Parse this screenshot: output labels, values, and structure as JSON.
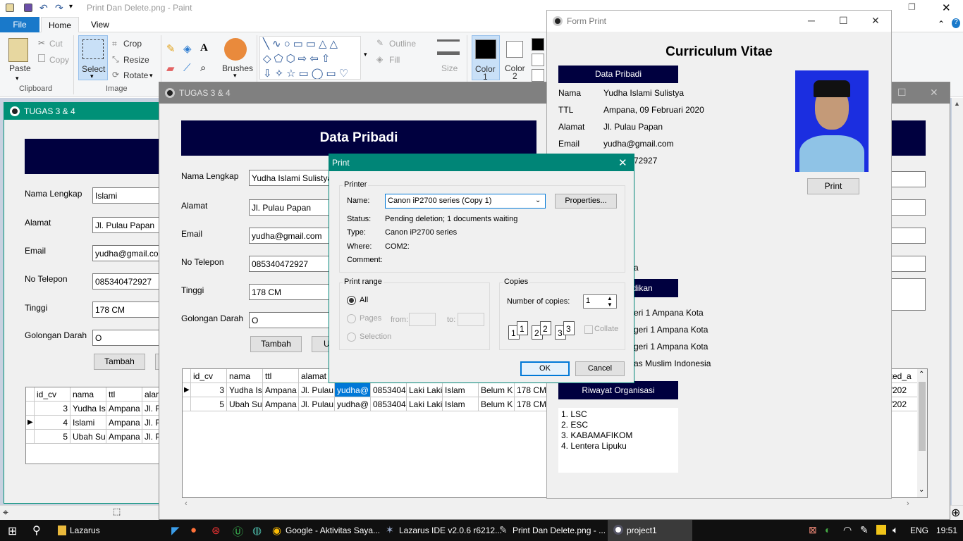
{
  "paint": {
    "title": "Print Dan Delete.png - Paint",
    "tabs": [
      "File",
      "Home",
      "View"
    ],
    "clipboard": {
      "paste": "Paste",
      "cut": "Cut",
      "copy": "Copy",
      "label": "Clipboard"
    },
    "image": {
      "select": "Select",
      "crop": "Crop",
      "resize": "Resize",
      "rotate": "Rotate",
      "label": "Image"
    },
    "tools": {
      "brushes": "Brushes",
      "outline": "Outline",
      "fill": "Fill",
      "size": "Size",
      "color1": "Color",
      "color1n": "1",
      "color2": "Color",
      "color2n": "2"
    }
  },
  "win_left": {
    "title": "TUGAS 3 & 4",
    "labels": [
      "Nama Lengkap",
      "Alamat",
      "Email",
      "No Telepon",
      "Tinggi",
      "Golongan Darah"
    ],
    "values": [
      "Islami",
      "Jl. Pulau Papan",
      "yudha@gmail.com",
      "085340472927",
      "178 CM",
      "O"
    ],
    "tambah": "Tambah",
    "grid": {
      "cols": [
        "id_cv",
        "nama",
        "ttl",
        "alamat"
      ],
      "rows": [
        [
          "3",
          "Yudha Is",
          "Ampana",
          "Jl. P"
        ],
        [
          "4",
          "Islami",
          "Ampana",
          "Jl. P"
        ],
        [
          "5",
          "Ubah Su",
          "Ampana",
          "Jl. P"
        ]
      ]
    }
  },
  "win_mid": {
    "title": "TUGAS 3 & 4",
    "header": "Data Pribadi",
    "labels": [
      "Nama Lengkap",
      "Alamat",
      "Email",
      "No Telepon",
      "Tinggi",
      "Golongan Darah"
    ],
    "values": [
      "Yudha Islami Sulistya",
      "Jl. Pulau Papan",
      "yudha@gmail.com",
      "085340472927",
      "178 CM",
      "O"
    ],
    "tambah": "Tambah",
    "ubah": "U",
    "grid": {
      "cols": [
        "id_cv",
        "nama",
        "ttl",
        "alamat",
        "",
        "",
        "",
        "",
        "",
        "",
        "",
        "ated_a"
      ],
      "rows": [
        [
          "3",
          "Yudha Is",
          "Ampana",
          "Jl. Pulau",
          "yudha@",
          "08534047",
          "Laki Laki",
          "Islam",
          "Belum K",
          "178 CM",
          "",
          "6/202"
        ],
        [
          "5",
          "Ubah Su",
          "Ampana",
          "Jl. Pulau",
          "yudha@",
          "08534047",
          "Laki Laki",
          "Islam",
          "Belum K",
          "178 CM",
          "",
          "6/202"
        ]
      ]
    }
  },
  "form_print": {
    "title": "Form Print",
    "heading": "Curriculum Vitae",
    "sec1": "Data Pribadi",
    "fields": [
      {
        "k": "Nama",
        "v": "Yudha Islami Sulistya"
      },
      {
        "k": "TTL",
        "v": "Ampana, 09 Februari 2020"
      },
      {
        "k": "Alamat",
        "v": "Jl. Pulau Papan"
      },
      {
        "k": "Email",
        "v": "yudha@gmail.com"
      }
    ],
    "phone_partial": "72927",
    "gender_partial": "a",
    "sec2_partial": "dikan",
    "edu": [
      "eri 1 Ampana Kota",
      "geri 1 Ampana Kota",
      "geri 1 Ampana Kota",
      "as Muslim Indonesia"
    ],
    "sec3": "Riwayat Organisasi",
    "orgs": [
      "1. LSC",
      "2. ESC",
      "3. KABAMAFIKOM",
      "4. Lentera Lipuku"
    ],
    "print": "Print"
  },
  "print_dialog": {
    "title": "Print",
    "printer": "Printer",
    "name_label": "Name:",
    "name_value": "Canon iP2700 series (Copy 1)",
    "properties": "Properties...",
    "status_label": "Status:",
    "status": "Pending deletion; 1 documents waiting",
    "type_label": "Type:",
    "type": "Canon iP2700 series",
    "where_label": "Where:",
    "where": "COM2:",
    "comment_label": "Comment:",
    "range": "Print range",
    "all": "All",
    "pages": "Pages",
    "from": "from:",
    "to": "to:",
    "selection": "Selection",
    "copies": "Copies",
    "num_copies": "Number of copies:",
    "copies_value": "1",
    "collate": "Collate",
    "ok": "OK",
    "cancel": "Cancel"
  },
  "taskbar": {
    "items": [
      "Lazarus",
      "Google - Aktivitas Saya...",
      "Lazarus IDE v2.0.6 r6212...",
      "Print Dan Delete.png - ...",
      "project1"
    ],
    "lang": "ENG",
    "time": "19:51"
  }
}
